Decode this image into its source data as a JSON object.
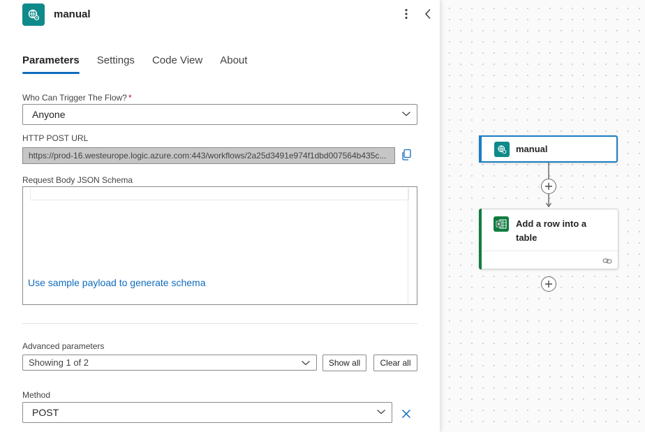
{
  "panel": {
    "title": "manual",
    "tabs": [
      {
        "label": "Parameters",
        "active": true
      },
      {
        "label": "Settings",
        "active": false
      },
      {
        "label": "Code View",
        "active": false
      },
      {
        "label": "About",
        "active": false
      }
    ],
    "who_can_trigger": {
      "label": "Who Can Trigger The Flow?",
      "required_mark": "*",
      "value": "Anyone"
    },
    "http_post_url": {
      "label": "HTTP POST URL",
      "value": "https://prod-16.westeurope.logic.azure.com:443/workflows/2a25d3491e974f1dbd007564b435c..."
    },
    "request_body": {
      "label": "Request Body JSON Schema",
      "sample_link": "Use sample payload to generate schema"
    },
    "advanced": {
      "label": "Advanced parameters",
      "value": "Showing 1 of 2",
      "show_all": "Show all",
      "clear_all": "Clear all"
    },
    "method": {
      "label": "Method",
      "value": "POST"
    }
  },
  "canvas": {
    "nodes": [
      {
        "title": "manual",
        "icon": "http-trigger-icon",
        "color": "#0f8a8a"
      },
      {
        "title": "Add a row into a table",
        "icon": "excel-icon",
        "color": "#107c41"
      }
    ]
  },
  "colors": {
    "accent": "#0f6cbd",
    "trigger": "#0f8a8a",
    "excel": "#107c41",
    "selected_border": "#1b7ec2"
  }
}
